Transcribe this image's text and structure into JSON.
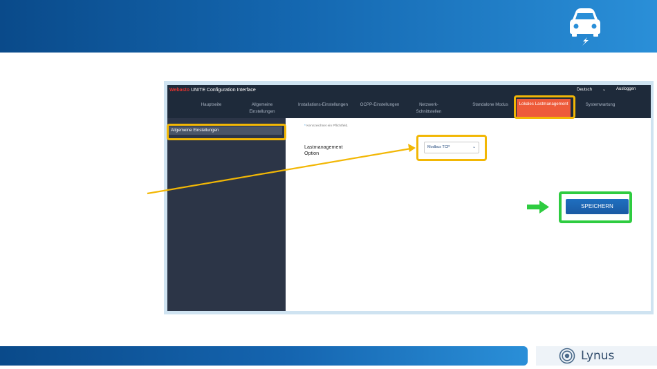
{
  "app": {
    "brand_mark": "Webasto",
    "title": "UNITE Configuration Interface",
    "language": "Deutsch",
    "logout": "Ausloggen"
  },
  "nav": [
    {
      "label": "Hauptseite",
      "active": false
    },
    {
      "label": "Allgemeine Einstellungen",
      "active": false
    },
    {
      "label": "Installations-Einstellungen",
      "active": false
    },
    {
      "label": "OCPP-Einstellungen",
      "active": false
    },
    {
      "label": "Netzwerk-Schnittstellen",
      "active": false
    },
    {
      "label": "Standalone Modus",
      "active": false
    },
    {
      "label": "Lokales Lastmanagement",
      "active": true
    },
    {
      "label": "Systemwartung",
      "active": false
    }
  ],
  "sidebar": {
    "items": [
      {
        "label": "Allgemeine Einstellungen",
        "selected": true
      }
    ]
  },
  "form": {
    "required_note": "Kennzeichnet ein Pflichtfeld.",
    "field_label": "Lastmanagement Option",
    "select_value": "Modbus TCP",
    "save_label": "SPEICHERN"
  },
  "footer": {
    "logo_text": "Lynus"
  },
  "colors": {
    "header_bg": "#1e2a3a",
    "sidebar_bg": "#2c3547",
    "active_tab": "#ee5b3a",
    "highlight_yellow": "#f2b705",
    "highlight_green": "#2ecc40",
    "save_button": "#1a5aa3"
  },
  "icons": {
    "banner": "electric-car-icon",
    "footer": "lynus-logo-icon"
  }
}
